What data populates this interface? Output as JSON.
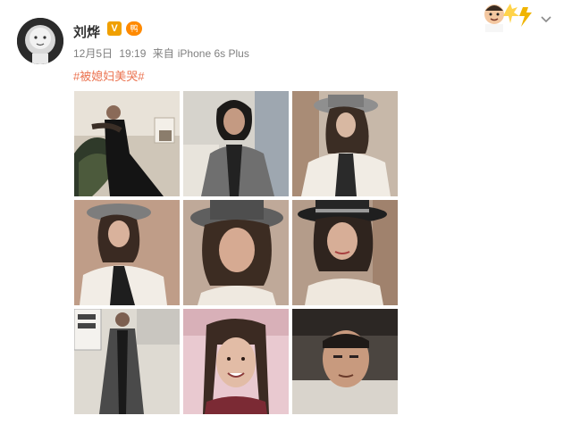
{
  "post": {
    "username": "刘烨",
    "verified_badge": "V",
    "level_badge": "鸭",
    "date": "12月5日",
    "time": "19:19",
    "source_prefix": "来自",
    "source_device": "iPhone 6s Plus",
    "hashtag": "#被媳妇美哭#"
  },
  "icons": {
    "avatar": "avatar-icon",
    "verified": "verified-badge-icon",
    "more": "chevron-down-icon",
    "corner": "cartoon-sticker-icon"
  },
  "colors": {
    "username": "#333333",
    "meta": "#808080",
    "hashtag": "#eb7350",
    "verified": "#f0a000"
  },
  "photos": [
    {
      "scene": "woman-in-black-seated-with-plant",
      "tone": "#6b6058"
    },
    {
      "scene": "woman-in-grey-blazer",
      "tone": "#8a8a8a"
    },
    {
      "scene": "woman-in-hat-white-blouse",
      "tone": "#bdb3a8"
    },
    {
      "scene": "woman-in-hat-pink-wall",
      "tone": "#b79a88"
    },
    {
      "scene": "woman-in-hat-closeup",
      "tone": "#a59488"
    },
    {
      "scene": "woman-in-top-hat-closeup",
      "tone": "#a69181"
    },
    {
      "scene": "woman-standing-grey-coat",
      "tone": "#5d5d5d"
    },
    {
      "scene": "girl-braided-hair-pink",
      "tone": "#c8a0ac"
    },
    {
      "scene": "man-selfie-dark",
      "tone": "#4a4440"
    }
  ]
}
